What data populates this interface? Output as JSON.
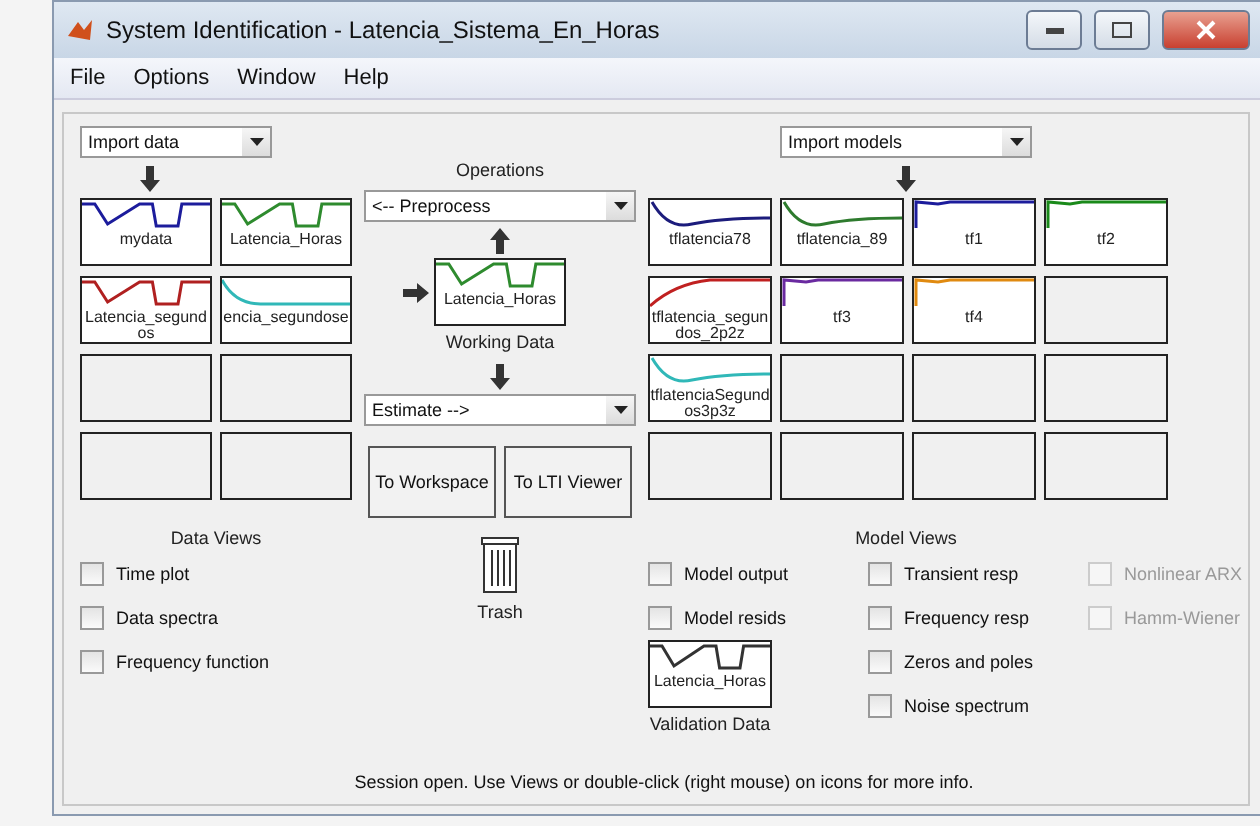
{
  "window": {
    "title": "System Identification - Latencia_Sistema_En_Horas"
  },
  "menu": [
    "File",
    "Options",
    "Window",
    "Help"
  ],
  "data_import": {
    "value": "Import data"
  },
  "data_tiles": [
    {
      "kind": "signal",
      "label": "mydata",
      "color": "#1c1c9c"
    },
    {
      "kind": "signal",
      "label": "Latencia_Horas",
      "color": "#2e8b2e"
    },
    {
      "kind": "signal",
      "label": "Latencia_segundos",
      "color": "#b02020"
    },
    {
      "kind": "decay",
      "label": "encia_segundose",
      "color": "#30b8b8"
    },
    {
      "kind": "empty"
    },
    {
      "kind": "empty"
    },
    {
      "kind": "empty"
    },
    {
      "kind": "empty"
    }
  ],
  "operations": {
    "title": "Operations",
    "preprocess": "<-- Preprocess",
    "working_data": {
      "label": "Latencia_Horas",
      "color": "#2e8b2e"
    },
    "working_caption": "Working Data",
    "estimate": "Estimate -->"
  },
  "buttons": [
    "To Workspace",
    "To LTI Viewer"
  ],
  "trash": {
    "label": "Trash"
  },
  "model_import": {
    "value": "Import models"
  },
  "model_tiles": [
    {
      "kind": "response",
      "label": "tflatencia78",
      "color": "#1c1c7c"
    },
    {
      "kind": "response",
      "label": "tflatencia_89",
      "color": "#2e7b2e"
    },
    {
      "kind": "flat",
      "label": "tf1",
      "color": "#1c1c9c"
    },
    {
      "kind": "flat",
      "label": "tf2",
      "color": "#1a8a1a"
    },
    {
      "kind": "rise",
      "label": "tflatencia_segundos_2p2z",
      "color": "#c02020"
    },
    {
      "kind": "flat",
      "label": "tf3",
      "color": "#6a2aa0"
    },
    {
      "kind": "flat",
      "label": "tf4",
      "color": "#e08a10"
    },
    {
      "kind": "empty"
    },
    {
      "kind": "response",
      "label": "tflatenciaSegundos3p3z",
      "color": "#30b8b8"
    },
    {
      "kind": "empty"
    },
    {
      "kind": "empty"
    },
    {
      "kind": "empty"
    },
    {
      "kind": "empty"
    },
    {
      "kind": "empty"
    },
    {
      "kind": "empty"
    },
    {
      "kind": "empty"
    }
  ],
  "data_views": {
    "title": "Data Views",
    "options": [
      {
        "label": "Time plot",
        "checked": false
      },
      {
        "label": "Data spectra",
        "checked": false
      },
      {
        "label": "Frequency function",
        "checked": false
      }
    ]
  },
  "model_views": {
    "title": "Model Views",
    "columns": [
      [
        {
          "label": "Model output",
          "checked": false,
          "disabled": false
        },
        {
          "label": "Model resids",
          "checked": false,
          "disabled": false
        }
      ],
      [
        {
          "label": "Transient resp",
          "checked": false,
          "disabled": false
        },
        {
          "label": "Frequency resp",
          "checked": false,
          "disabled": false
        },
        {
          "label": "Zeros and poles",
          "checked": false,
          "disabled": false
        },
        {
          "label": "Noise spectrum",
          "checked": false,
          "disabled": false
        }
      ],
      [
        {
          "label": "Nonlinear ARX",
          "checked": false,
          "disabled": true
        },
        {
          "label": "Hamm-Wiener",
          "checked": false,
          "disabled": true
        }
      ]
    ]
  },
  "validation": {
    "label": "Latencia_Horas",
    "color": "#333333",
    "caption": "Validation Data"
  },
  "status_bar": "Session open. Use Views or double-click (right mouse) on icons for more info."
}
